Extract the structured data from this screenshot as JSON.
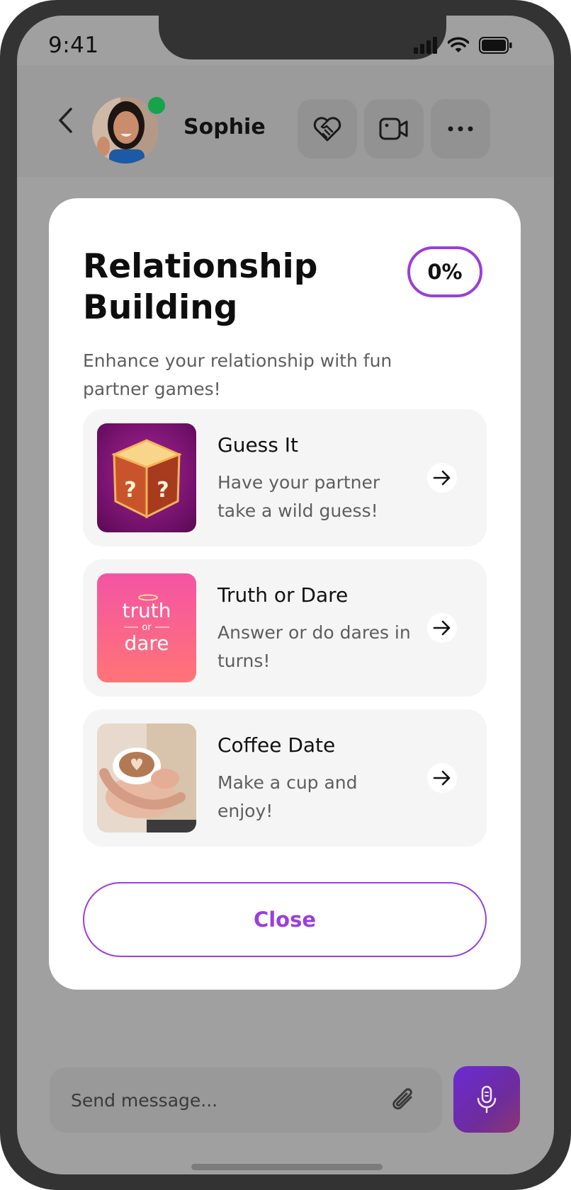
{
  "status_bar": {
    "time": "9:41"
  },
  "header": {
    "contact_name": "Sophie"
  },
  "modal": {
    "title": "Relationship Building",
    "progress": "0%",
    "subtitle": "Enhance your relationship with fun partner games!",
    "games": [
      {
        "title": "Guess It",
        "description": "Have your partner take a wild guess!"
      },
      {
        "title": "Truth or Dare",
        "description": "Answer or do dares in turns!"
      },
      {
        "title": "Coffee Date",
        "description": "Make a cup and enjoy!"
      }
    ],
    "close_label": "Close"
  },
  "composer": {
    "placeholder": "Send message..."
  },
  "thumb_text": {
    "truth": "truth",
    "or": "or",
    "dare": "dare",
    "q": "?"
  },
  "colors": {
    "accent": "#9a3fd9",
    "online": "#16a34a",
    "mic_gradient_start": "#6b2bd4",
    "mic_gradient_end": "#8d3670"
  }
}
